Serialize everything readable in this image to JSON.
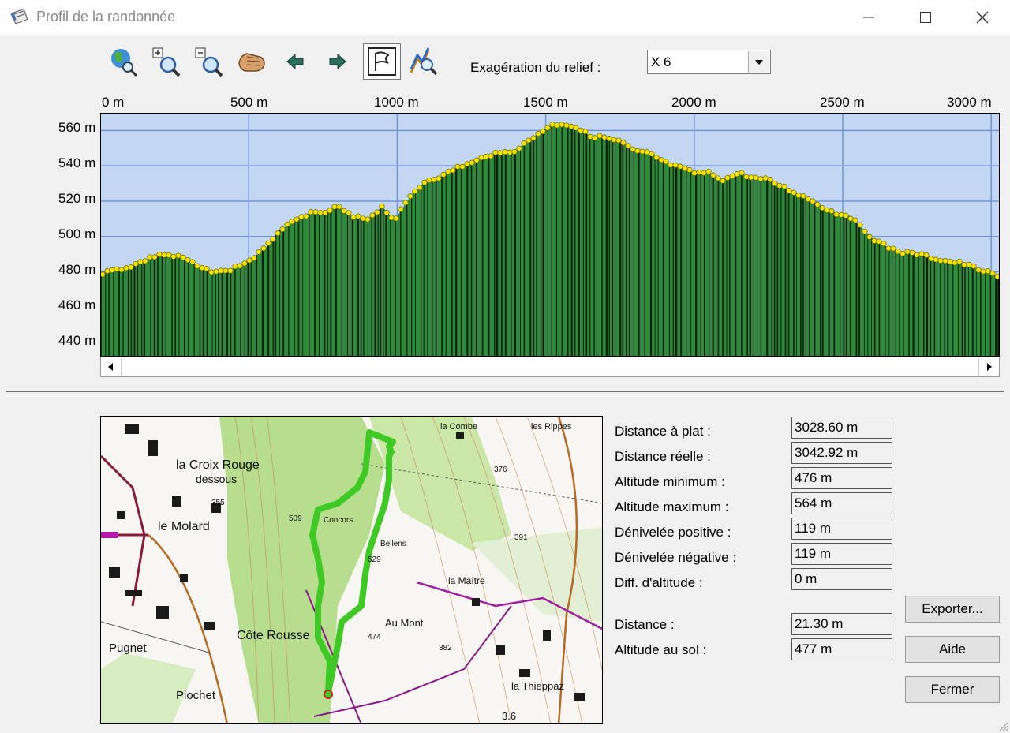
{
  "window": {
    "title": "Profil de la randonnée",
    "minimize_icon": "minimize-icon",
    "maximize_icon": "maximize-icon",
    "close_icon": "close-icon"
  },
  "toolbar": {
    "icons": [
      "globe-zoom-icon",
      "zoom-in-icon",
      "zoom-out-icon",
      "pan-hand-icon",
      "arrow-left-icon",
      "arrow-right-icon",
      "flag-icon",
      "profile-zoom-icon"
    ],
    "exaggeration_label": "Exagération du relief :",
    "exaggeration_value": "X 6"
  },
  "profile": {
    "x_ticks": [
      "0 m",
      "500 m",
      "1000 m",
      "1500 m",
      "2000 m",
      "2500 m",
      "3000 m"
    ],
    "y_ticks": [
      "560 m",
      "540 m",
      "520 m",
      "500 m",
      "480 m",
      "460 m",
      "440 m"
    ],
    "colors": {
      "sky": "#c3d7f3",
      "grid": "#6f93d6",
      "terrain": "#2f8a3c",
      "stripe": "#0e1f10",
      "point": "#f5e400",
      "point_stroke": "#6b6200"
    }
  },
  "chart_data": {
    "type": "area",
    "title": "",
    "xlabel": "",
    "ylabel": "",
    "xlim": [
      0,
      3028.6
    ],
    "ylim": [
      432,
      570
    ],
    "grid": true,
    "x_ticks": [
      0,
      500,
      1000,
      1500,
      2000,
      2500,
      3000
    ],
    "y_ticks": [
      440,
      460,
      480,
      500,
      520,
      540,
      560
    ],
    "series": [
      {
        "x": [
          0,
          100,
          200,
          280,
          350,
          420,
          500,
          560,
          600,
          650,
          700,
          750,
          800,
          850,
          900,
          950,
          990,
          1050,
          1100,
          1150,
          1200,
          1260,
          1300,
          1350,
          1400,
          1450,
          1480,
          1520,
          1560,
          1600,
          1650,
          1700,
          1760,
          1800,
          1850,
          1900,
          1950,
          2000,
          2050,
          2100,
          2150,
          2200,
          2250,
          2300,
          2350,
          2400,
          2450,
          2480,
          2520,
          2600,
          2650,
          2700,
          2750,
          2800,
          2850,
          2900,
          2950,
          3028.6
        ],
        "values": [
          479,
          483,
          490,
          488,
          481,
          480,
          486,
          494,
          503,
          508,
          513,
          513,
          517,
          511,
          510,
          517,
          509,
          524,
          532,
          534,
          539,
          542,
          546,
          547,
          549,
          555,
          559,
          563,
          564,
          562,
          557,
          556,
          553,
          548,
          547,
          542,
          539,
          536,
          536,
          532,
          536,
          533,
          532,
          528,
          524,
          520,
          515,
          513,
          512,
          499,
          494,
          491,
          490,
          488,
          486,
          485,
          482,
          477
        ]
      }
    ],
    "annotations": {
      "distance_a_plat": "3028.60 m",
      "altitude_minimum": "476 m",
      "altitude_maximum": "564 m"
    }
  },
  "map": {
    "labels": {
      "croix_rouge": "la Croix Rouge",
      "dessous": "dessous",
      "molard": "le Molard",
      "cote_rousse": "Côte Rousse",
      "pugnet": "Pugnet",
      "piochet": "Piochet",
      "combe": "la Combe",
      "rippes": "les Rippes",
      "maitre": "la Maître",
      "au_mont": "Au Mont",
      "thieppaz": "la Thieppaz",
      "concors": "Concors",
      "bellens": "Bellens",
      "n355": "355",
      "n376": "376",
      "n391": "391",
      "n474": "474",
      "n382": "382",
      "n509": "509",
      "n529": "529",
      "n36": "3.6"
    }
  },
  "stats": [
    {
      "label": "Distance à plat :",
      "value": "3028.60 m"
    },
    {
      "label": "Distance réelle :",
      "value": "3042.92 m"
    },
    {
      "label": "Altitude minimum :",
      "value": "476 m"
    },
    {
      "label": "Altitude maximum :",
      "value": "564 m"
    },
    {
      "label": "Dénivelée positive :",
      "value": "119 m"
    },
    {
      "label": "Dénivelée négative :",
      "value": "119 m"
    },
    {
      "label": "Diff. d'altitude :",
      "value": "0 m"
    }
  ],
  "cursor": [
    {
      "label": "Distance :",
      "value": "21.30 m"
    },
    {
      "label": "Altitude au sol :",
      "value": "477 m"
    }
  ],
  "buttons": {
    "export": "Exporter...",
    "help": "Aide",
    "close": "Fermer"
  }
}
